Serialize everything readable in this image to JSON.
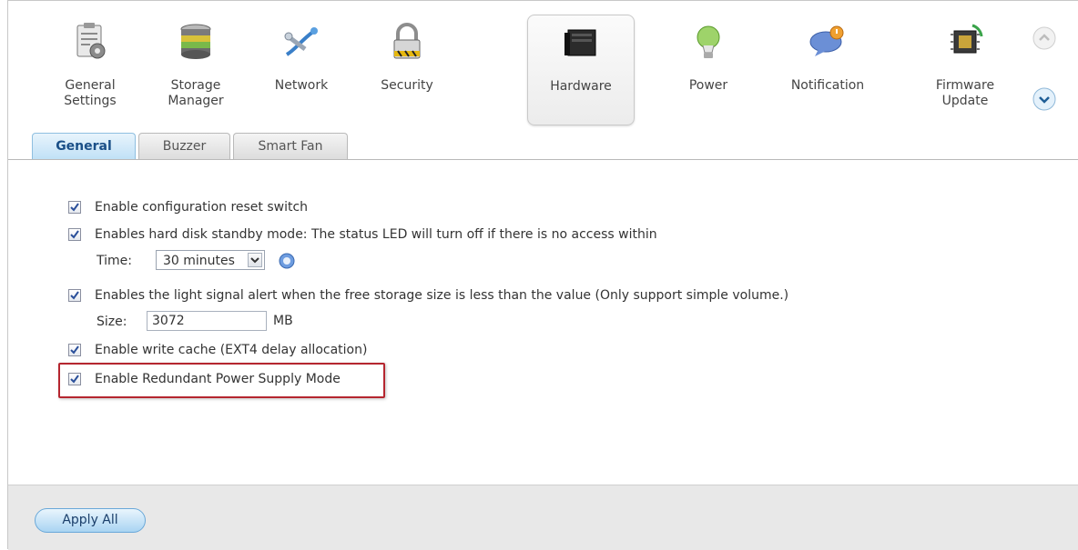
{
  "nav": {
    "items": [
      {
        "id": "general-settings",
        "label_lines": [
          "General",
          "Settings"
        ],
        "icon": "clipboard-gear-icon"
      },
      {
        "id": "storage-manager",
        "label_lines": [
          "Storage",
          "Manager"
        ],
        "icon": "disk-stack-icon"
      },
      {
        "id": "network",
        "label_lines": [
          "Network"
        ],
        "icon": "network-cable-icon"
      },
      {
        "id": "security",
        "label_lines": [
          "Security"
        ],
        "icon": "padlock-icon"
      },
      {
        "id": "hardware",
        "label_lines": [
          "Hardware"
        ],
        "icon": "server-box-icon",
        "active": true
      },
      {
        "id": "power",
        "label_lines": [
          "Power"
        ],
        "icon": "lightbulb-icon"
      },
      {
        "id": "notification",
        "label_lines": [
          "Notification"
        ],
        "icon": "speech-bubble-alert-icon"
      },
      {
        "id": "firmware-update",
        "label_lines": [
          "Firmware",
          "Update"
        ],
        "icon": "chip-refresh-icon"
      }
    ],
    "scroll_up_icon": "chevron-up-icon",
    "scroll_down_icon": "chevron-down-icon"
  },
  "tabs": [
    {
      "label": "General",
      "active": true
    },
    {
      "label": "Buzzer",
      "active": false
    },
    {
      "label": "Smart Fan",
      "active": false
    }
  ],
  "options": {
    "config_reset": {
      "label": "Enable configuration reset switch",
      "checked": true
    },
    "standby": {
      "label": "Enables hard disk standby mode: The status LED will turn off if there is no access within",
      "checked": true
    },
    "time": {
      "label": "Time:",
      "value": "30 minutes",
      "help_icon": "help-icon"
    },
    "light_alert": {
      "label": "Enables the light signal alert when the free storage size is less than the value (Only support simple volume.)",
      "checked": true
    },
    "size": {
      "label": "Size:",
      "value": "3072",
      "unit": "MB"
    },
    "write_cache": {
      "label": "Enable write cache (EXT4 delay allocation)",
      "checked": true
    },
    "redundant_power": {
      "label": "Enable Redundant Power Supply Mode",
      "checked": true
    }
  },
  "footer": {
    "apply_label": "Apply All"
  },
  "colors": {
    "accent": "#8fbfe0",
    "highlight_border": "#b5262f"
  }
}
